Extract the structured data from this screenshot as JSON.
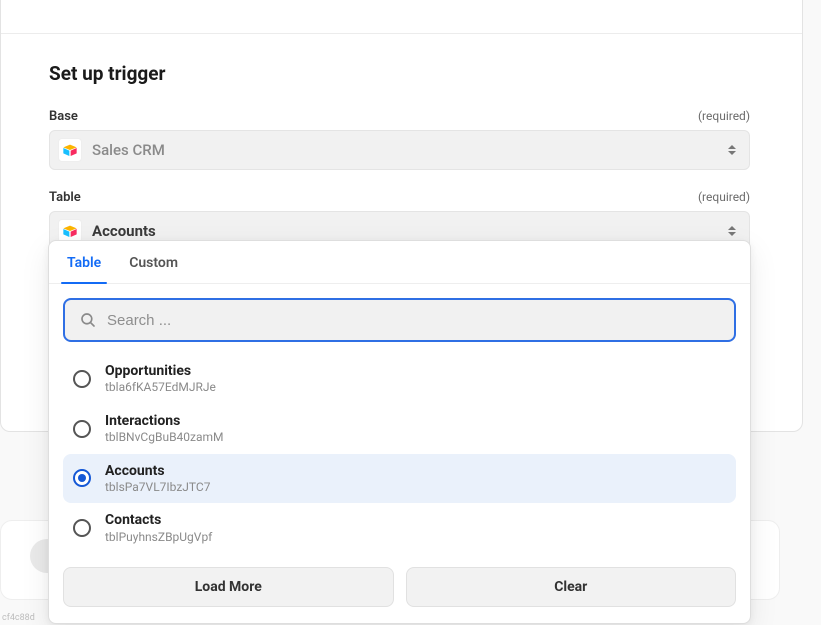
{
  "header": {
    "title": "Set up trigger"
  },
  "fields": {
    "base": {
      "label": "Base",
      "required_text": "(required)",
      "value": "Sales CRM"
    },
    "table": {
      "label": "Table",
      "required_text": "(required)",
      "value": "Accounts"
    }
  },
  "dropdown": {
    "tabs": [
      {
        "label": "Table",
        "active": true
      },
      {
        "label": "Custom",
        "active": false
      }
    ],
    "search": {
      "placeholder": "Search ..."
    },
    "options": [
      {
        "title": "Opportunities",
        "sub": "tbla6fKA57EdMJRJe",
        "selected": false
      },
      {
        "title": "Interactions",
        "sub": "tblBNvCgBuB40zamM",
        "selected": false
      },
      {
        "title": "Accounts",
        "sub": "tblsPa7VL7IbzJTC7",
        "selected": true
      },
      {
        "title": "Contacts",
        "sub": "tblPuyhnsZBpUgVpf",
        "selected": false
      }
    ],
    "actions": {
      "load_more": "Load More",
      "clear": "Clear"
    }
  },
  "watermark": "cf4c88d"
}
